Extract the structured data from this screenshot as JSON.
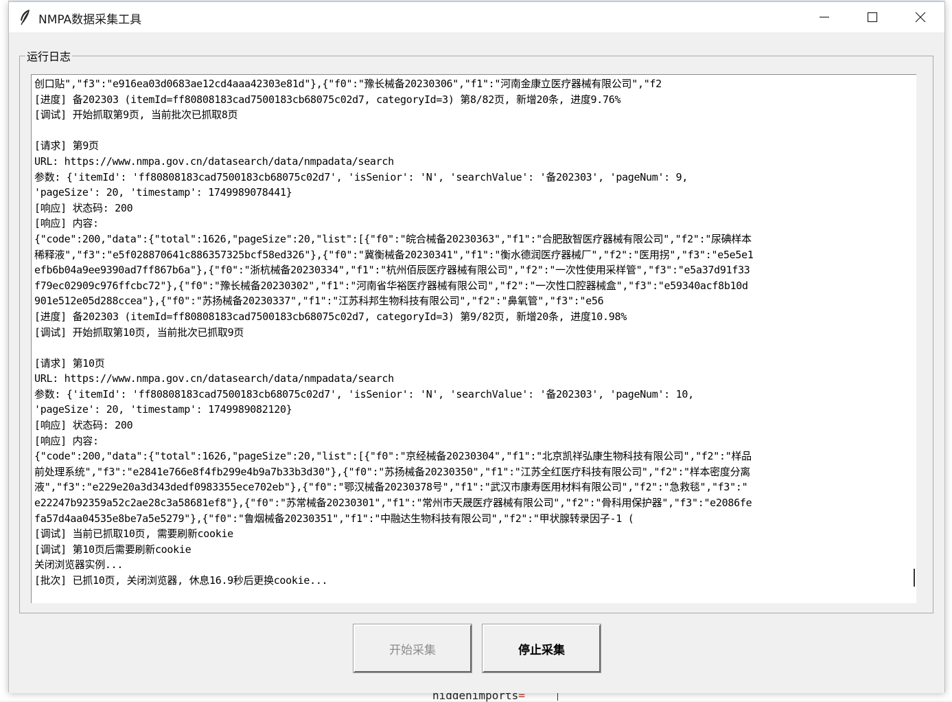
{
  "background": {
    "code_text": "hiddenimports",
    "code_eq": "="
  },
  "window": {
    "title": "NMPA数据采集工具",
    "controls": {
      "minimize": "—",
      "maximize": "☐",
      "close": "✕"
    }
  },
  "log_frame": {
    "legend": "运行日志",
    "lines": [
      "创口贴\",\"f3\":\"e916ea03d0683ae12cd4aaa42303e81d\"},{\"f0\":\"豫长械备20230306\",\"f1\":\"河南金康立医疗器械有限公司\",\"f2",
      "[进度] 备202303 (itemId=ff80808183cad7500183cb68075c02d7, categoryId=3) 第8/82页, 新增20条, 进度9.76%",
      "[调试] 开始抓取第9页, 当前批次已抓取8页",
      "",
      "[请求] 第9页",
      "URL: https://www.nmpa.gov.cn/datasearch/data/nmpadata/search",
      "参数: {'itemId': 'ff80808183cad7500183cb68075c02d7', 'isSenior': 'N', 'searchValue': '备202303', 'pageNum': 9,",
      "'pageSize': 20, 'timestamp': 1749989078441}",
      "[响应] 状态码: 200",
      "[响应] 内容:",
      "{\"code\":200,\"data\":{\"total\":1626,\"pageSize\":20,\"list\":[{\"f0\":\"皖合械备20230363\",\"f1\":\"合肥敔智医疗器械有限公司\",\"f2\":\"尿碘样本",
      "稀释液\",\"f3\":\"e5f028870641c886357325bcf58ed326\"},{\"f0\":\"冀衡械备20230341\",\"f1\":\"衡水德润医疗器械厂\",\"f2\":\"医用拐\",\"f3\":\"e5e5e1",
      "efb6b04a9ee9390ad7ff867b6a\"},{\"f0\":\"浙杭械备20230334\",\"f1\":\"杭州佰辰医疗器械有限公司\",\"f2\":\"一次性使用采样管\",\"f3\":\"e5a37d91f33",
      "f79ec02909c976ffcbc72\"},{\"f0\":\"豫长械备20230302\",\"f1\":\"河南省华裕医疗器械有限公司\",\"f2\":\"一次性口腔器械盒\",\"f3\":\"e59340acf8b10d",
      "901e512e05d288ccea\"},{\"f0\":\"苏扬械备20230337\",\"f1\":\"江苏科邦生物科技有限公司\",\"f2\":\"鼻氧管\",\"f3\":\"e56",
      "[进度] 备202303 (itemId=ff80808183cad7500183cb68075c02d7, categoryId=3) 第9/82页, 新增20条, 进度10.98%",
      "[调试] 开始抓取第10页, 当前批次已抓取9页",
      "",
      "[请求] 第10页",
      "URL: https://www.nmpa.gov.cn/datasearch/data/nmpadata/search",
      "参数: {'itemId': 'ff80808183cad7500183cb68075c02d7', 'isSenior': 'N', 'searchValue': '备202303', 'pageNum': 10,",
      "'pageSize': 20, 'timestamp': 1749989082120}",
      "[响应] 状态码: 200",
      "[响应] 内容:",
      "{\"code\":200,\"data\":{\"total\":1626,\"pageSize\":20,\"list\":[{\"f0\":\"京经械备20230304\",\"f1\":\"北京凯祥弘康生物科技有限公司\",\"f2\":\"样品",
      "前处理系统\",\"f3\":\"e2841e766e8f4fb299e4b9a7b33b3d30\"},{\"f0\":\"苏扬械备20230350\",\"f1\":\"江苏全红医疗科技有限公司\",\"f2\":\"样本密度分离",
      "液\",\"f3\":\"e229e20a3d343dedf0983355ece702eb\"},{\"f0\":\"鄂汉械备20230378号\",\"f1\":\"武汉市康寿医用材料有限公司\",\"f2\":\"急救毯\",\"f3\":\"",
      "e22247b92359a52c2ae28c3a58681ef8\"},{\"f0\":\"苏常械备20230301\",\"f1\":\"常州市天晟医疗器械有限公司\",\"f2\":\"骨科用保护器\",\"f3\":\"e2086fe",
      "fa57d4aa04535e8be7a5e5279\"},{\"f0\":\"鲁烟械备20230351\",\"f1\":\"中融达生物科技有限公司\",\"f2\":\"甲状腺转录因子-1 (",
      "[调试] 当前已抓取10页, 需要刷新cookie",
      "[调试] 第10页后需要刷新cookie",
      "关闭浏览器实例...",
      "[批次] 已抓10页, 关闭浏览器, 休息16.9秒后更换cookie..."
    ]
  },
  "buttons": {
    "start_label": "开始采集",
    "stop_label": "停止采集"
  }
}
